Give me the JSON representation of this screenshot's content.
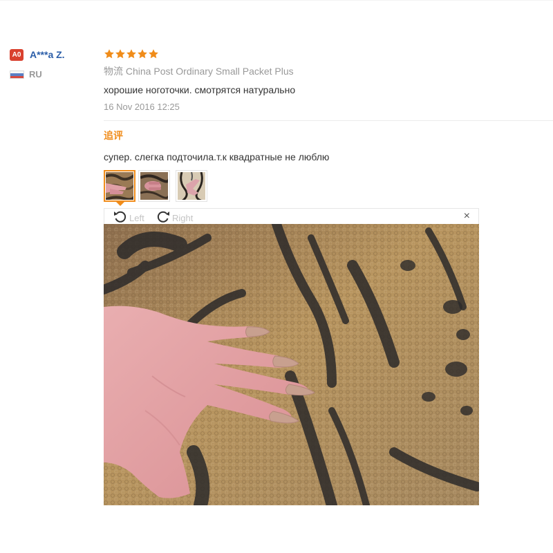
{
  "user": {
    "level_badge": "A0",
    "name": "A***a Z.",
    "country": "RU"
  },
  "feedback": {
    "rating": 5,
    "star_color": "#f08c1a",
    "shipping_label": "物流",
    "shipping_method": "China Post Ordinary Small Packet Plus",
    "text": "хорошие ноготочки. смотрятся натурально",
    "date": "16 Nov 2016 12:25"
  },
  "additional_feedback": {
    "title": "追评",
    "text": "супер. слегка подточила.т.к квадратные не люблю"
  },
  "gallery": {
    "thumbnails": [
      {
        "name": "photo 1",
        "active": true
      },
      {
        "name": "photo 2",
        "active": false
      },
      {
        "name": "photo 3",
        "active": false
      }
    ],
    "accent_color": "#f08c1a"
  },
  "viewer": {
    "rotate_left_label": "Left",
    "rotate_right_label": "Right",
    "close_label": "×",
    "icons": [
      "rotate-left-icon",
      "rotate-right-icon",
      "close-icon"
    ]
  }
}
